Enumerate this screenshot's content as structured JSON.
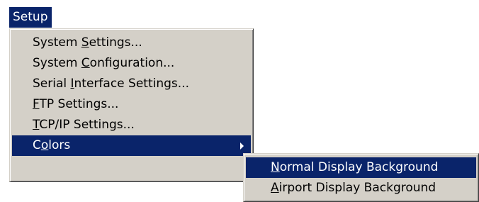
{
  "menubar": {
    "title": "Setup"
  },
  "setup_menu": {
    "items": [
      {
        "pre": "System ",
        "key": "S",
        "post": "ettings..."
      },
      {
        "pre": "System ",
        "key": "C",
        "post": "onfiguration..."
      },
      {
        "pre": "Serial ",
        "key": "I",
        "post": "nterface Settings..."
      },
      {
        "pre": "",
        "key": "F",
        "post": "TP Settings..."
      },
      {
        "pre": "",
        "key": "T",
        "post": "CP/IP Settings..."
      },
      {
        "pre": "C",
        "key": "o",
        "post": "lors"
      }
    ]
  },
  "colors_submenu": {
    "items": [
      {
        "pre": "",
        "key": "N",
        "post": "ormal Display Background"
      },
      {
        "pre": "",
        "key": "A",
        "post": "irport Display Background"
      }
    ]
  },
  "colors": {
    "menu_background": "#d4d0c8",
    "highlight": "#0a246a",
    "highlight_text": "#ffffff"
  },
  "icons": {
    "submenu_arrow": "submenu-arrow-icon"
  }
}
